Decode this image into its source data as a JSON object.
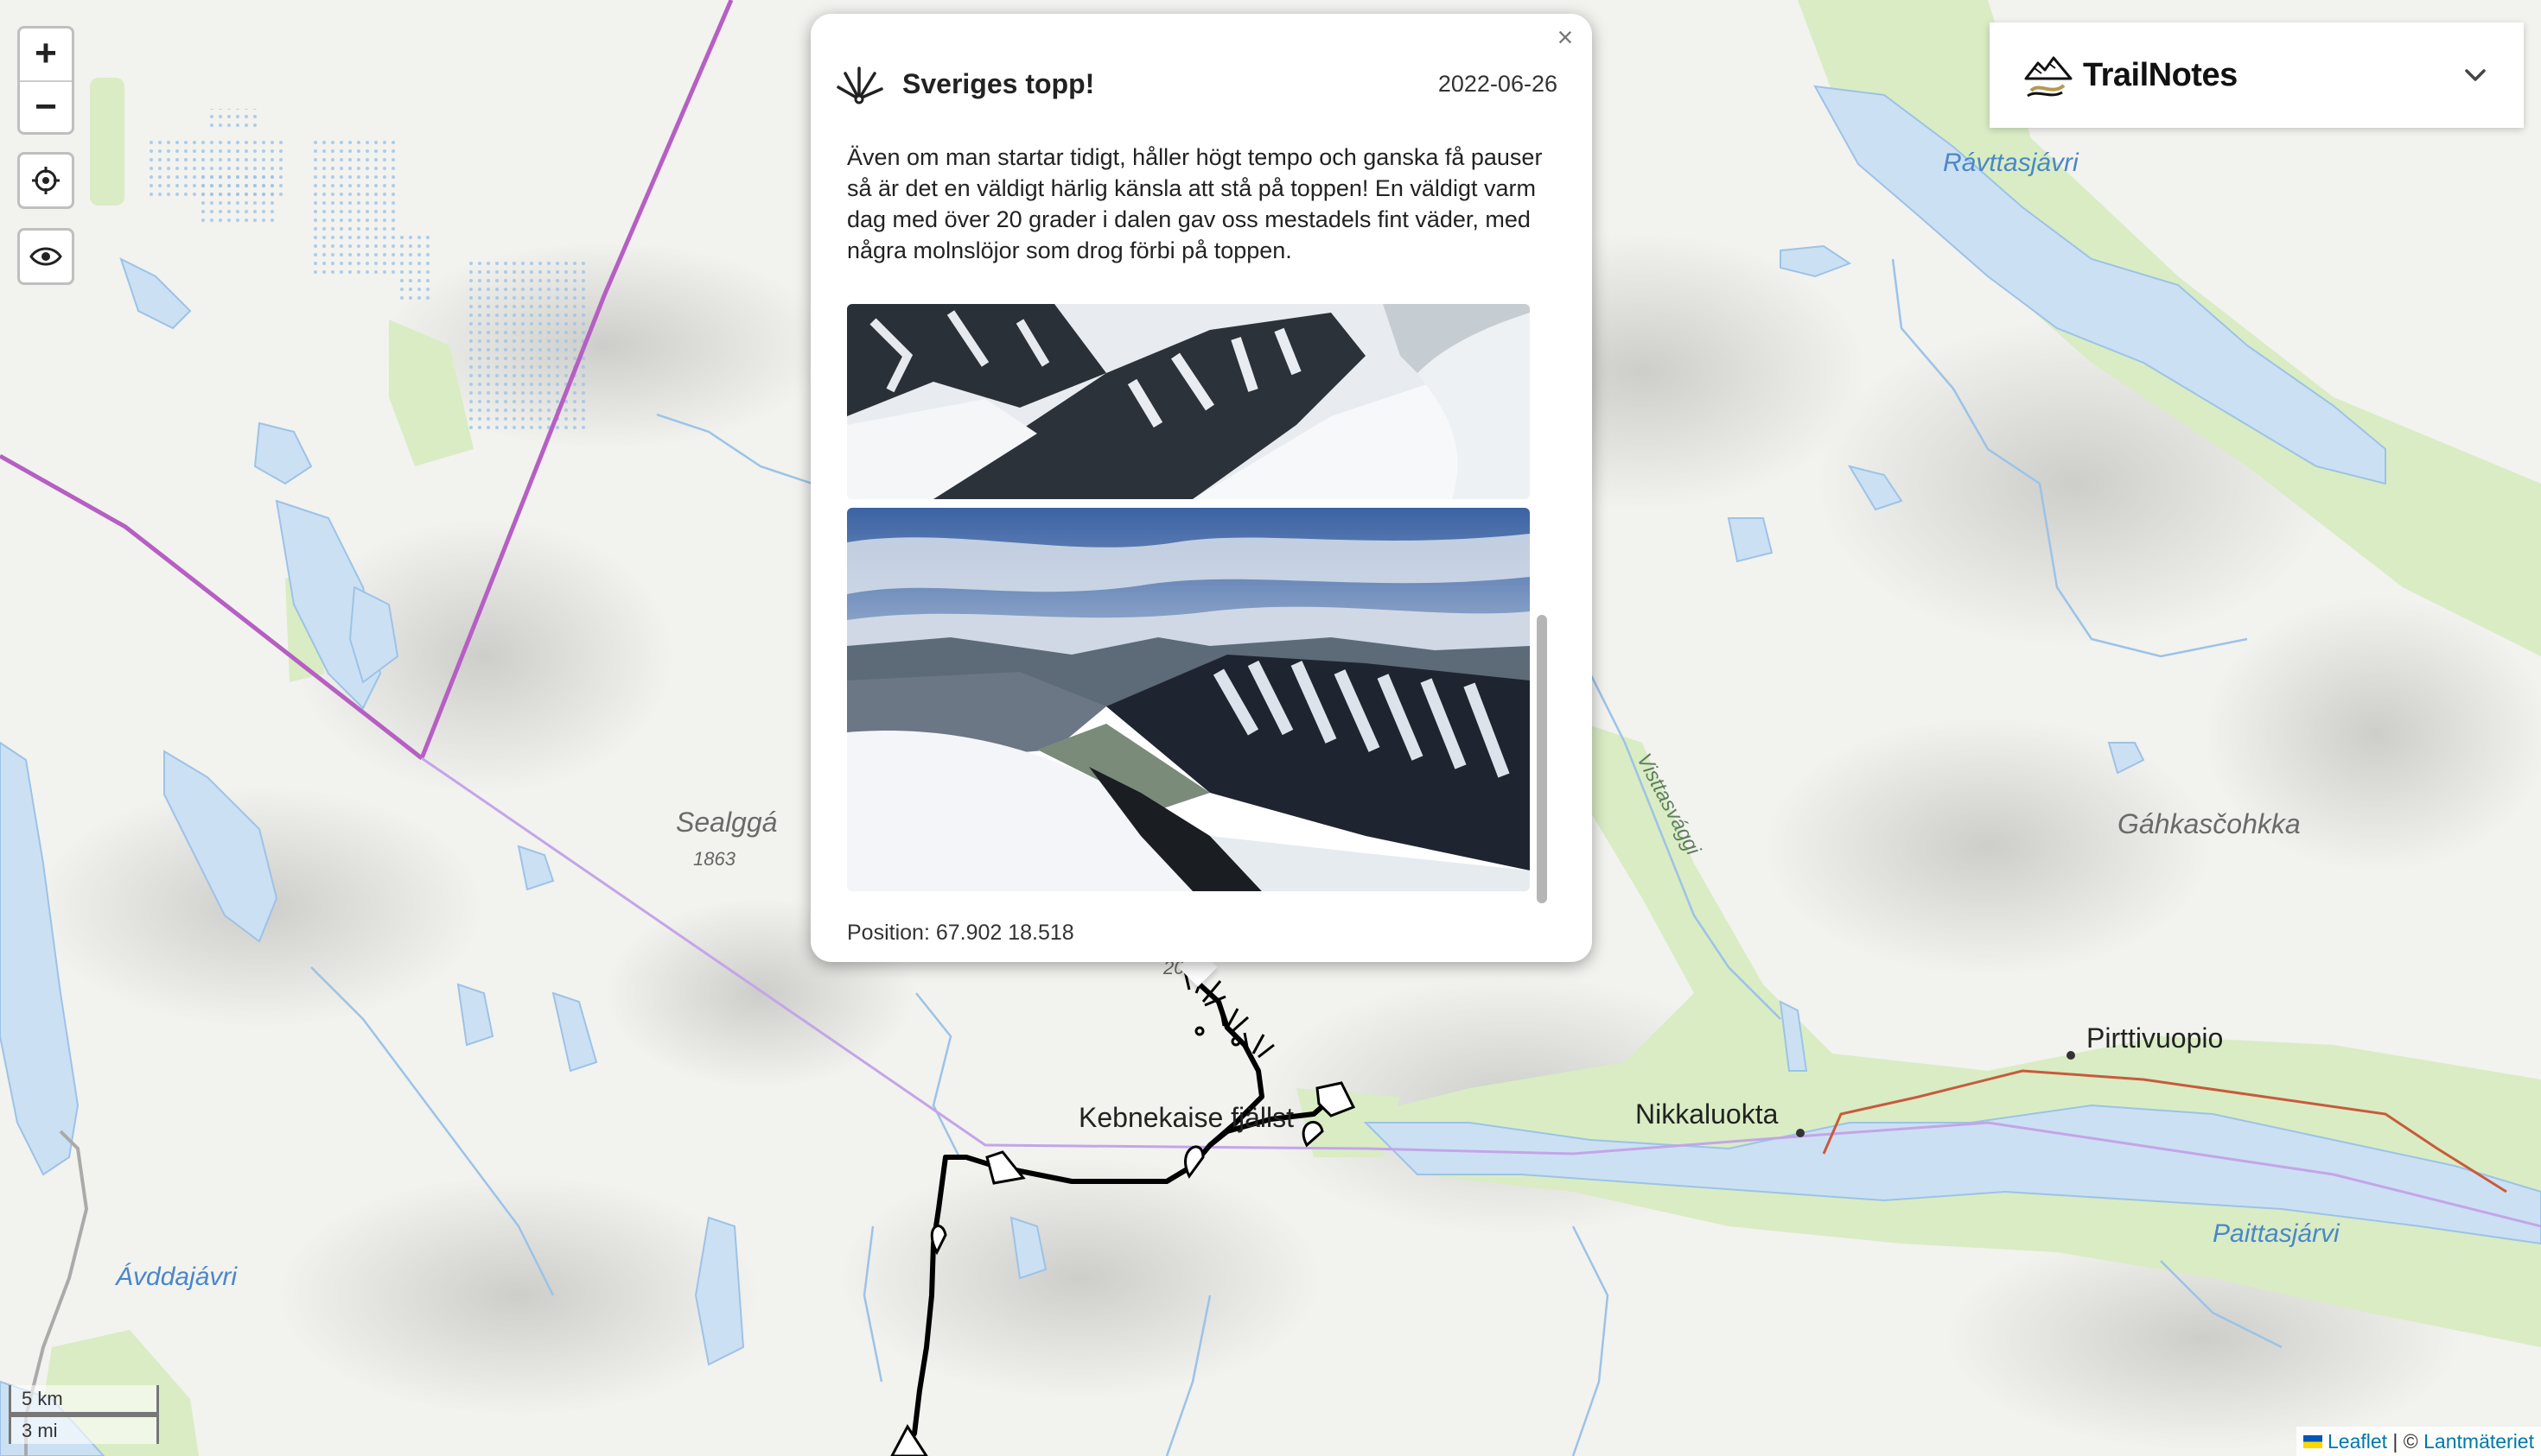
{
  "map": {
    "labels": {
      "ravttasjavri": "Rávttasjávri",
      "sealgga": "Sealggá",
      "sealgga_elev": "1863",
      "visttasvaggi": "Visttasvággi",
      "gahkascohkka": "Gáhkasčohkka",
      "pirttivuopio": "Pirttivuopio",
      "nikkaluokta": "Nikkaluokta",
      "kebnekaise": "Kebnekaise fjällst",
      "avddajavri": "Ávddajávri",
      "paittasjavri": "Paittasjárvi",
      "peak_elev": "20"
    },
    "colors": {
      "land": "#f2f2ef",
      "forest": "#d9ecc4",
      "water": "#cce0f3",
      "trail": "#000000",
      "boundary": "#b65fc3",
      "road": "#c85a3c"
    }
  },
  "controls": {
    "zoom_in": "+",
    "zoom_out": "−",
    "locate_icon": "crosshair-icon",
    "visibility_icon": "eye-icon"
  },
  "app": {
    "title": "TrailNotes",
    "logo_icon": "hiker-mountain-icon",
    "menu_icon": "chevron-down-icon"
  },
  "popup": {
    "close": "×",
    "icon": "summit-burst-icon",
    "title": "Sveriges topp!",
    "date": "2022-06-26",
    "body": "Även om man startar tidigt, håller högt tempo och ganska få pauser så är det en väldigt härlig känsla att stå på toppen! En väldigt varm dag med över 20 grader i dalen gav oss mestadels fint väder, med några molnslöjor som drog förbi på toppen.",
    "position": "Position: 67.902 18.518"
  },
  "scale": {
    "metric": "5 km",
    "imperial": "3 mi"
  },
  "attribution": {
    "leaflet": "Leaflet",
    "separator": " | © ",
    "source": "Lantmäteriet"
  }
}
